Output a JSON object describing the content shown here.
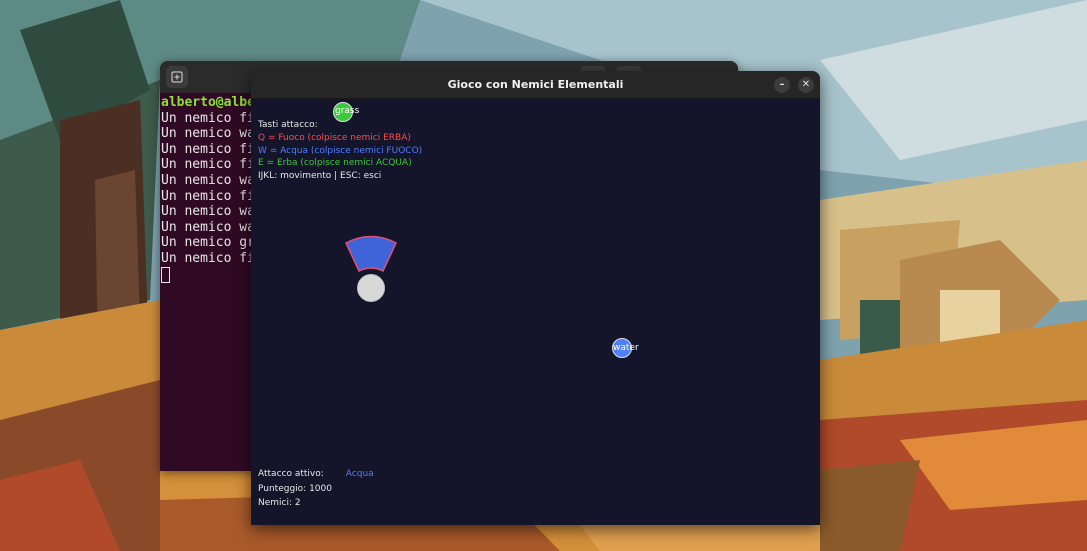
{
  "terminal": {
    "prompt": "alberto@alber",
    "lines": [
      "Un nemico fir",
      "Un nemico wat",
      "Un nemico fir",
      "Un nemico fir",
      "Un nemico wat",
      "Un nemico fir",
      "Un nemico wat",
      "Un nemico wat",
      "Un nemico gra",
      "Un nemico fir"
    ]
  },
  "game_window": {
    "title": "Gioco con Nemici Elementali",
    "minimize_symbol": "–",
    "close_symbol": "✕"
  },
  "instructions": {
    "heading": "Tasti attacco:",
    "fire": "Q = Fuoco (colpisce nemici ERBA)",
    "water": "W = Acqua (colpisce nemici FUOCO)",
    "grass": "E = Erba (colpisce nemici ACQUA)",
    "controls": "IJKL: movimento | ESC: esci"
  },
  "enemies": {
    "grass_label": "grass",
    "water_label": "water"
  },
  "status": {
    "active_attack_label": "Attacco attivo:",
    "active_attack_value": "Acqua",
    "score": "Punteggio: 1000",
    "enemies_count": "Nemici: 2"
  },
  "colors": {
    "game_bg": "#14142a",
    "fire": "#ff4d4d",
    "water": "#4f7fff",
    "grass": "#3cc83c",
    "attack_cone": "#3f64d8",
    "attack_cone_outline": "#e0507a",
    "terminal_bg": "#300a24"
  }
}
